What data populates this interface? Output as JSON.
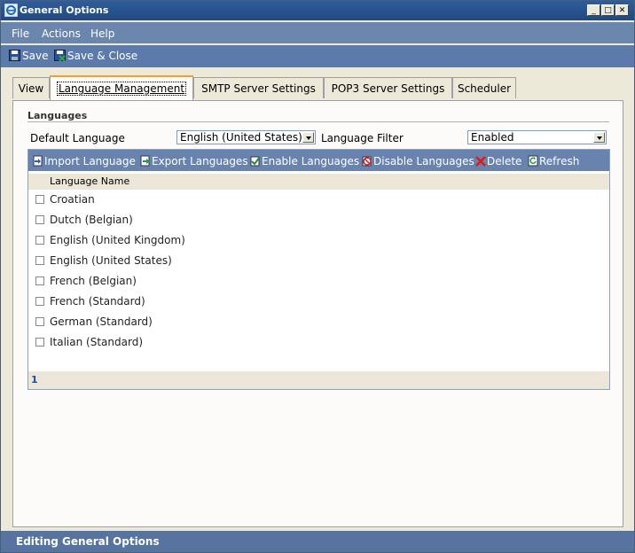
{
  "window": {
    "title": "General Options",
    "controls": [
      "minimize-icon",
      "maximize-icon",
      "close-icon"
    ]
  },
  "menu": [
    "File",
    "Actions",
    "Help"
  ],
  "toolbar": {
    "save_label": "Save",
    "save_close_label": "Save & Close"
  },
  "tabs": [
    {
      "label": "View",
      "active": false
    },
    {
      "label": "Language Management",
      "active": true
    },
    {
      "label": "SMTP Server Settings",
      "active": false
    },
    {
      "label": "POP3 Server Settings",
      "active": false
    },
    {
      "label": "Scheduler",
      "active": false
    }
  ],
  "languages": {
    "section_title": "Languages",
    "default_language_label": "Default Language",
    "default_language_value": "English (United States)",
    "filter_label": "Language Filter",
    "filter_value": "Enabled",
    "actions": [
      {
        "label": "Import Language",
        "icon": "import-icon"
      },
      {
        "label": "Export Languages",
        "icon": "export-icon"
      },
      {
        "label": "Enable Languages",
        "icon": "enable-check-icon"
      },
      {
        "label": "Disable Languages",
        "icon": "disable-icon"
      },
      {
        "label": "Delete",
        "icon": "delete-x-icon"
      },
      {
        "label": "Refresh",
        "icon": "refresh-icon"
      }
    ],
    "column_header": "Language Name",
    "rows": [
      "Croatian",
      "Dutch (Belgian)",
      "English (United Kingdom)",
      "English (United States)",
      "French (Belgian)",
      "French (Standard)",
      "German (Standard)",
      "Italian (Standard)"
    ],
    "page": "1"
  },
  "status": "Editing General Options",
  "colors": {
    "titlebar": "#2f5d9c",
    "menubar": "#6b86ad",
    "toolbar": "#5c7baa",
    "gridbar": "#6883ae",
    "statusbar": "#56749f",
    "tab_accent": "#f0a030"
  }
}
